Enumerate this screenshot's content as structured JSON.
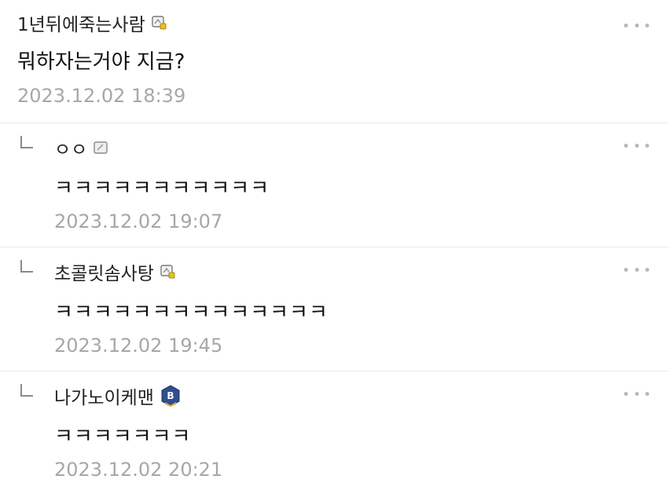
{
  "comments": [
    {
      "author": "1년뒤에죽는사람",
      "badge": "level-icon-yellow",
      "text": "뭐하자는거야 지금?",
      "time": "2023.12.02 18:39"
    },
    {
      "author": "ㅇㅇ",
      "badge": "level-icon-gray",
      "text": "ㅋㅋㅋㅋㅋㅋㅋㅋㅋㅋㅋ",
      "time": "2023.12.02 19:07"
    },
    {
      "author": "초콜릿솜사탕",
      "badge": "level-icon-yellow",
      "text": "ㅋㅋㅋㅋㅋㅋㅋㅋㅋㅋㅋㅋㅋㅋ",
      "time": "2023.12.02 19:45"
    },
    {
      "author": "나가노이케맨",
      "badge": "b-badge-icon",
      "badge_letter": "B",
      "text": "ㅋㅋㅋㅋㅋㅋㅋ",
      "time": "2023.12.02 20:21"
    }
  ],
  "colors": {
    "text": "#222222",
    "timestamp": "#a7a7a7",
    "divider": "#e9e9e9",
    "badge_blue": "#2f4f8f",
    "badge_gold": "#e7b43a"
  }
}
